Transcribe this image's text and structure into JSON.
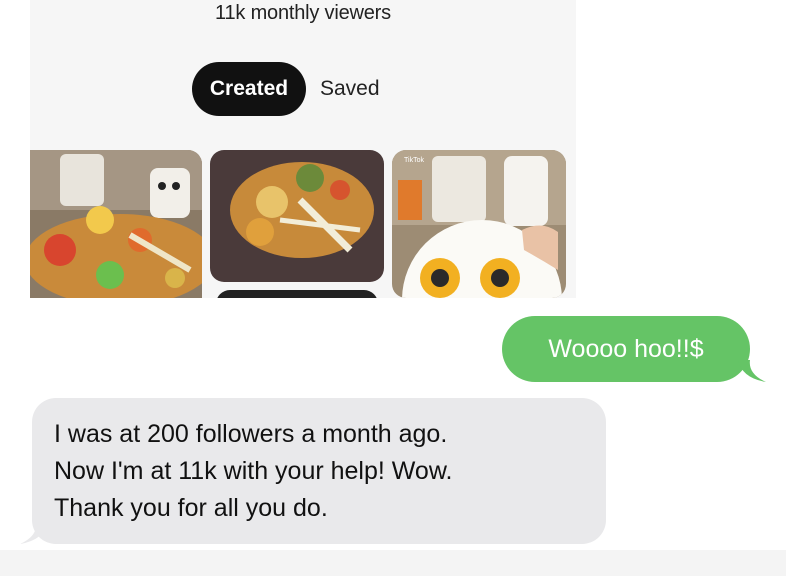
{
  "profile_screenshot": {
    "viewers": "11k monthly viewers",
    "tabs": {
      "created": "Created",
      "saved": "Saved"
    },
    "thumbnail_overlay_text": "TikTok"
  },
  "messages": {
    "outgoing": "Woooo hoo!!$",
    "incoming_lines": [
      "I was at 200 followers a month ago.",
      "Now I'm at 11k with your help! Wow.",
      "Thank you for all you do."
    ]
  },
  "colors": {
    "outgoing_bubble": "#65c466",
    "incoming_bubble": "#e9e9eb",
    "active_tab": "#111111"
  }
}
